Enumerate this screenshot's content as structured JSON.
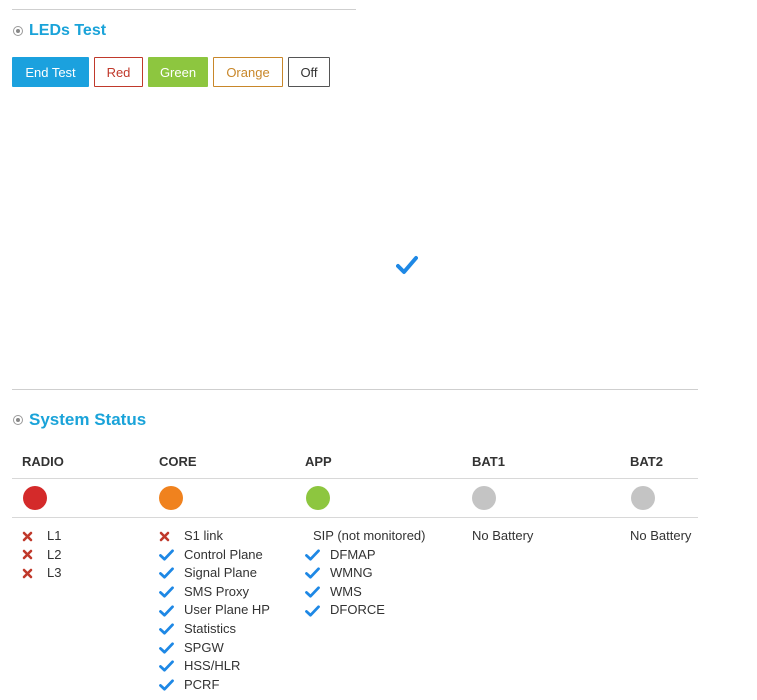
{
  "leds_test": {
    "title": "LEDs Test",
    "buttons": {
      "end_test": "End Test",
      "red": "Red",
      "green": "Green",
      "orange": "Orange",
      "off": "Off"
    }
  },
  "system_status": {
    "title": "System Status",
    "columns": [
      {
        "header": "RADIO",
        "indicator_color": "#d42a2a",
        "items": [
          {
            "status": "error",
            "label": "L1"
          },
          {
            "status": "error",
            "label": "L2"
          },
          {
            "status": "error",
            "label": "L3"
          }
        ]
      },
      {
        "header": "CORE",
        "indicator_color": "#f0821e",
        "items": [
          {
            "status": "error",
            "label": "S1 link"
          },
          {
            "status": "ok",
            "label": "Control Plane"
          },
          {
            "status": "ok",
            "label": "Signal Plane"
          },
          {
            "status": "ok",
            "label": "SMS Proxy"
          },
          {
            "status": "ok",
            "label": "User Plane HP"
          },
          {
            "status": "ok",
            "label": "Statistics"
          },
          {
            "status": "ok",
            "label": "SPGW"
          },
          {
            "status": "ok",
            "label": "HSS/HLR"
          },
          {
            "status": "ok",
            "label": "PCRF"
          }
        ]
      },
      {
        "header": "APP",
        "indicator_color": "#8dc63f",
        "items": [
          {
            "status": "none",
            "label": "SIP (not monitored)"
          },
          {
            "status": "ok",
            "label": "DFMAP"
          },
          {
            "status": "ok",
            "label": "WMNG"
          },
          {
            "status": "ok",
            "label": "WMS"
          },
          {
            "status": "ok",
            "label": "DFORCE"
          }
        ]
      },
      {
        "header": "BAT1",
        "indicator_color": "#c4c4c4",
        "items": [
          {
            "status": "text",
            "label": "No Battery"
          }
        ]
      },
      {
        "header": "BAT2",
        "indicator_color": "#c4c4c4",
        "items": [
          {
            "status": "text",
            "label": "No Battery"
          }
        ]
      }
    ]
  },
  "colors": {
    "accent": "#1aa3d9",
    "check": "#1e88e5",
    "error": "#c0392b"
  }
}
